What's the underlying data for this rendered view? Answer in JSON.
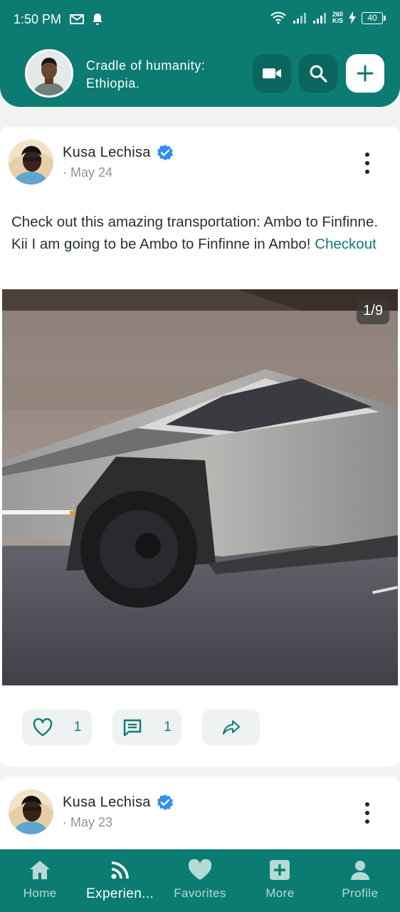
{
  "status_bar": {
    "time": "1:50 PM",
    "speed_top": "260",
    "speed_bottom": "K/S",
    "battery": "40"
  },
  "header": {
    "title": "Cradle of humanity: Ethiopia."
  },
  "posts": [
    {
      "author": "Kusa Lechisa",
      "date": "· May 24",
      "text": "Check out this amazing transportation: Ambo to Finfinne. Kii I am going to be  Ambo to Finfinne in Ambo!",
      "link_label": "Checkout",
      "media_counter": "1/9",
      "likes": "1",
      "comments": "1"
    },
    {
      "author": "Kusa Lechisa",
      "date": "· May 23"
    }
  ],
  "bottom_nav": {
    "items": [
      {
        "label": "Home",
        "icon": "home-icon"
      },
      {
        "label": "Experien...",
        "icon": "rss-feed-icon"
      },
      {
        "label": "Favorites",
        "icon": "heart-icon"
      },
      {
        "label": "More",
        "icon": "plus-box-icon"
      },
      {
        "label": "Profile",
        "icon": "person-icon"
      }
    ]
  },
  "colors": {
    "accent": "#0c7c72",
    "accent_dark": "#0a665e",
    "verified": "#2f8ff0"
  }
}
